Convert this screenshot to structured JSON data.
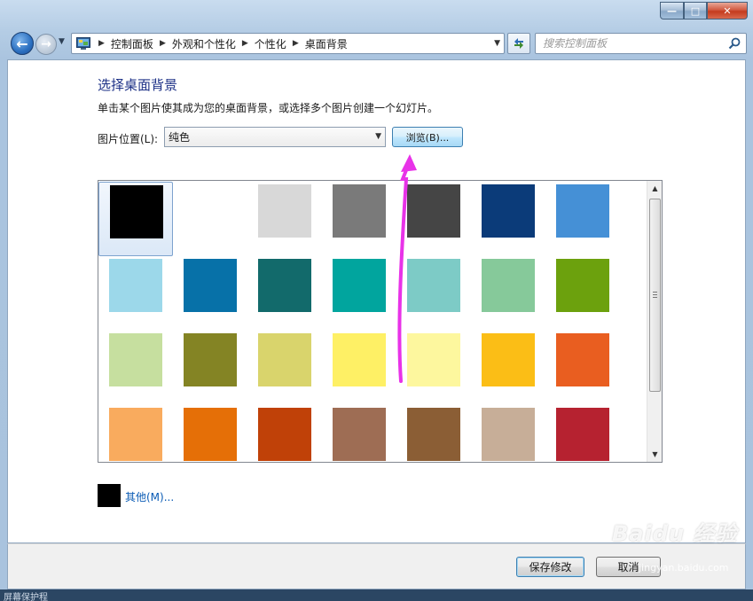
{
  "window": {
    "caption_min": "—",
    "caption_max": "□",
    "caption_close": "✕"
  },
  "nav": {
    "back_glyph": "←",
    "forward_glyph": "→",
    "history_glyph": "▼",
    "breadcrumb": [
      "控制面板",
      "外观和个性化",
      "个性化",
      "桌面背景"
    ],
    "breadcrumb_sep": "▶",
    "address_dropdown_glyph": "▼",
    "search_placeholder": "搜索控制面板"
  },
  "page": {
    "heading": "选择桌面背景",
    "description": "单击某个图片使其成为您的桌面背景，或选择多个图片创建一个幻灯片。",
    "location_label": "图片位置(L):",
    "location_value": "纯色",
    "location_arrow": "▼",
    "browse_label": "浏览(B)...",
    "swatches": [
      "#000000",
      "#ffffff",
      "#d8d8d8",
      "#7a7a7a",
      "#454545",
      "#0b3b79",
      "#4590d6",
      "#9cd8ea",
      "#0771a8",
      "#126a6b",
      "#01a59e",
      "#7dcbc6",
      "#86c99a",
      "#6ca10d",
      "#c6df9f",
      "#848424",
      "#d9d46c",
      "#fef065",
      "#fdf79e",
      "#fbbe16",
      "#e95e20",
      "#f9ab5e",
      "#e56f07",
      "#c04108",
      "#9e6d54",
      "#8b5e35",
      "#c7ae98",
      "#b62230"
    ],
    "selected_index": 0,
    "scroll_up": "▲",
    "scroll_down": "▼",
    "other_color": "#000000",
    "other_label": "其他(M)..."
  },
  "footer": {
    "save_label": "保存修改",
    "cancel_label": "取消"
  },
  "watermark": {
    "main": "Baidu 经验",
    "sub": "jingyan.baidu.com"
  },
  "bottom_strip": {
    "text": "屏幕保护程"
  },
  "colors": {
    "annotation_arrow": "#e832e8",
    "link": "#0a5bb5",
    "heading": "#1e3287"
  }
}
